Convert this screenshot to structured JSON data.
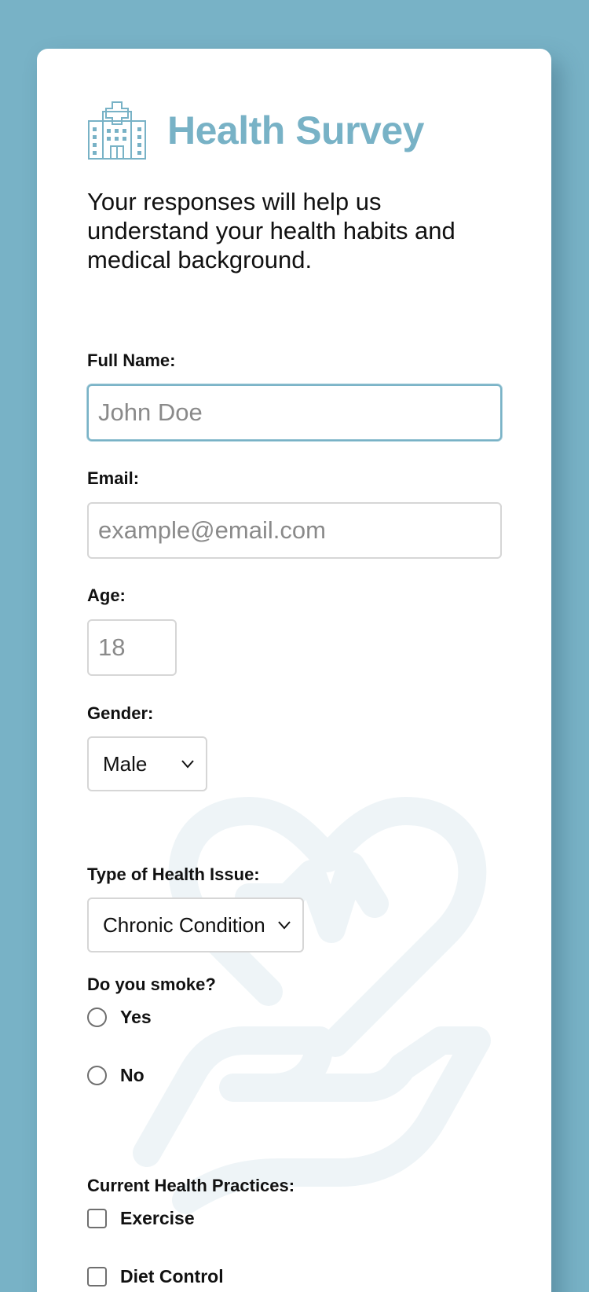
{
  "header": {
    "icon": "hospital-icon",
    "title": "Health Survey",
    "intro": "Your responses will help us understand your health habits and medical background."
  },
  "fields": {
    "full_name": {
      "label": "Full Name:",
      "placeholder": "John Doe",
      "value": ""
    },
    "email": {
      "label": "Email:",
      "placeholder": "example@email.com",
      "value": ""
    },
    "age": {
      "label": "Age:",
      "placeholder": "18",
      "value": ""
    },
    "gender": {
      "label": "Gender:",
      "selected": "Male"
    },
    "health_issue": {
      "label": "Type of Health Issue:",
      "selected": "Chronic Condition"
    },
    "smoke": {
      "label": "Do you smoke?",
      "options": [
        {
          "label": "Yes",
          "checked": false
        },
        {
          "label": "No",
          "checked": false
        }
      ]
    },
    "practices": {
      "label": "Current Health Practices:",
      "options": [
        {
          "label": "Exercise",
          "checked": false
        },
        {
          "label": "Diet Control",
          "checked": false
        }
      ]
    }
  },
  "colors": {
    "accent": "#78b2c6",
    "background": "#78b2c6",
    "card": "#ffffff",
    "watermark": "#eef4f7"
  },
  "decor": {
    "watermark_icon": "heart-in-hand-icon"
  }
}
